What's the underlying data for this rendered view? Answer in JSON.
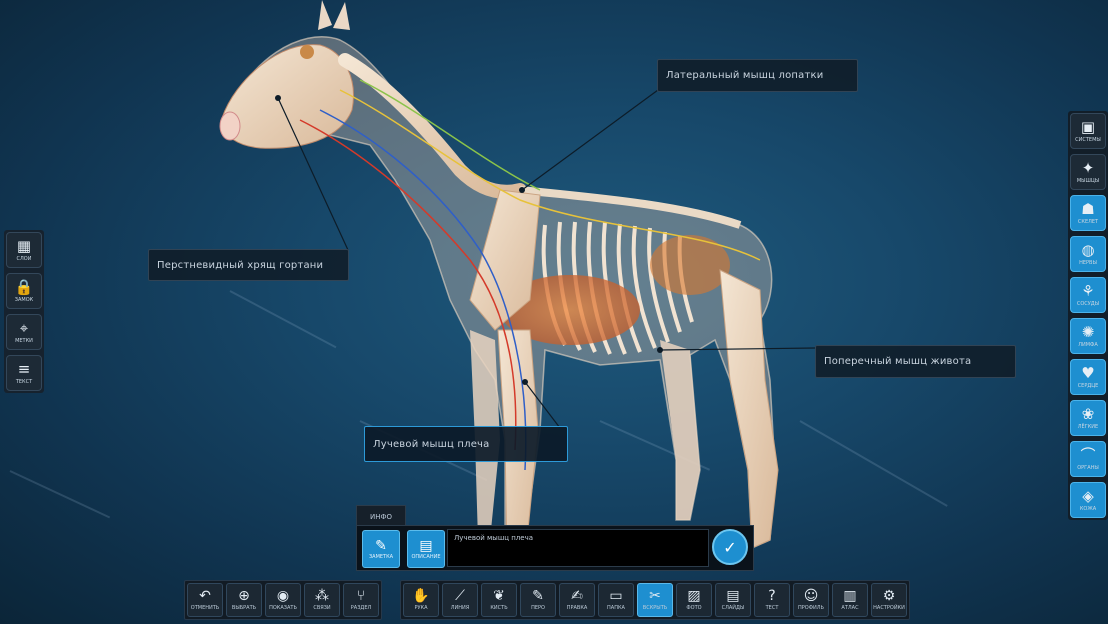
{
  "colors": {
    "accent": "#1e8fd0",
    "background": "#17486a",
    "panel": "#121b24"
  },
  "callouts": [
    {
      "id": "neck",
      "text": "Перстневидный хрящ гортани"
    },
    {
      "id": "shoulder",
      "text": "Латеральный мышц лопатки"
    },
    {
      "id": "flank",
      "text": "Поперечный мышц живота"
    },
    {
      "id": "foreleg",
      "text": "Лучевой мышц плеча",
      "active": true
    }
  ],
  "left_toolbar": [
    {
      "icon": "layers-icon",
      "glyph": "▦",
      "label": "СЛОИ"
    },
    {
      "icon": "lock-icon",
      "glyph": "🔒",
      "label": "ЗАМОК"
    },
    {
      "icon": "tag-icon",
      "glyph": "⌖",
      "label": "МЕТКИ"
    },
    {
      "icon": "text-icon",
      "glyph": "≡",
      "label": "ТЕКСТ"
    }
  ],
  "right_toolbar": [
    {
      "icon": "system-icon",
      "glyph": "▣",
      "label": "СИСТЕМЫ",
      "active": false
    },
    {
      "icon": "muscle-icon",
      "glyph": "✦",
      "label": "МЫШЦЫ",
      "active": false
    },
    {
      "icon": "skeleton-icon",
      "glyph": "☗",
      "label": "СКЕЛЕТ",
      "active": true
    },
    {
      "icon": "nerve-icon",
      "glyph": "◍",
      "label": "НЕРВЫ",
      "active": true
    },
    {
      "icon": "vessel-icon",
      "glyph": "⚘",
      "label": "СОСУДЫ",
      "active": true
    },
    {
      "icon": "lymph-icon",
      "glyph": "✺",
      "label": "ЛИМФА",
      "active": true
    },
    {
      "icon": "heart-icon",
      "glyph": "♥",
      "label": "СЕРДЦЕ",
      "active": true
    },
    {
      "icon": "lungs-icon",
      "glyph": "❀",
      "label": "ЛЁГКИЕ",
      "active": true
    },
    {
      "icon": "organ-icon",
      "glyph": "⌒",
      "label": "ОРГАНЫ",
      "active": true
    },
    {
      "icon": "skin-icon",
      "glyph": "◈",
      "label": "КОЖА",
      "active": true
    }
  ],
  "info_panel": {
    "tab": "ИНФО",
    "left_icon_label": "ЗАМЕТКА",
    "right_icon_label": "ОПИСАНИЕ",
    "text": "Лучевой мышц плеча",
    "confirm": "✓"
  },
  "bottom_toolbar_left": [
    {
      "icon": "undo-icon",
      "glyph": "↶",
      "label": "ОТМЕНИТЬ"
    },
    {
      "icon": "select-icon",
      "glyph": "⊕",
      "label": "ВЫБРАТЬ"
    },
    {
      "icon": "eye-icon",
      "glyph": "◉",
      "label": "ПОКАЗАТЬ"
    },
    {
      "icon": "network-icon",
      "glyph": "⁂",
      "label": "СВЯЗИ"
    },
    {
      "icon": "fork-icon",
      "glyph": "⑂",
      "label": "РАЗДЕЛ"
    }
  ],
  "bottom_toolbar_right": [
    {
      "icon": "hand-icon",
      "glyph": "✋",
      "label": "РУКА",
      "active": false
    },
    {
      "icon": "ruler-icon",
      "glyph": "⟋",
      "label": "ЛИНИЯ",
      "active": false
    },
    {
      "icon": "paint-icon",
      "glyph": "❦",
      "label": "КИСТЬ",
      "active": false
    },
    {
      "icon": "pen-icon",
      "glyph": "✎",
      "label": "ПЕРО",
      "active": false
    },
    {
      "icon": "edit-icon",
      "glyph": "✍",
      "label": "ПРАВКА",
      "active": false
    },
    {
      "icon": "folder-icon",
      "glyph": "▭",
      "label": "ПАПКА",
      "active": false
    },
    {
      "icon": "dissect-icon",
      "glyph": "✂",
      "label": "ВСКРЫТЬ",
      "active": true
    },
    {
      "icon": "image-icon",
      "glyph": "▨",
      "label": "ФОТО",
      "active": false
    },
    {
      "icon": "slides-icon",
      "glyph": "▤",
      "label": "СЛАЙДЫ",
      "active": false
    },
    {
      "icon": "quiz-icon",
      "glyph": "?",
      "label": "ТЕСТ",
      "active": false
    },
    {
      "icon": "user-icon",
      "glyph": "☺",
      "label": "ПРОФИЛЬ",
      "active": false
    },
    {
      "icon": "book-icon",
      "glyph": "▥",
      "label": "АТЛАС",
      "active": false
    },
    {
      "icon": "settings-icon",
      "glyph": "⚙",
      "label": "НАСТРОЙКИ",
      "active": false
    }
  ]
}
